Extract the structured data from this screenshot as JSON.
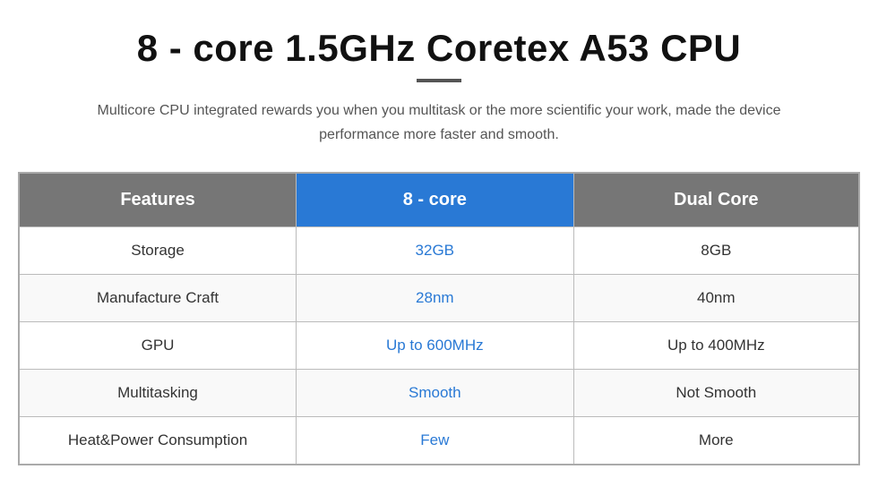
{
  "title": "8 - core 1.5GHz Coretex A53 CPU",
  "subtitle": "Multicore CPU integrated rewards you when you multitask or the more scientific your work, made the device performance more faster and smooth.",
  "table": {
    "headers": {
      "features": "Features",
      "col1": "8 - core",
      "col2": "Dual Core"
    },
    "rows": [
      {
        "feature": "Storage",
        "col1": "32GB",
        "col2": "8GB"
      },
      {
        "feature": "Manufacture Craft",
        "col1": "28nm",
        "col2": "40nm"
      },
      {
        "feature": "GPU",
        "col1": "Up to 600MHz",
        "col2": "Up to 400MHz"
      },
      {
        "feature": "Multitasking",
        "col1": "Smooth",
        "col2": "Not Smooth"
      },
      {
        "feature": "Heat&Power Consumption",
        "col1": "Few",
        "col2": "More"
      }
    ]
  }
}
